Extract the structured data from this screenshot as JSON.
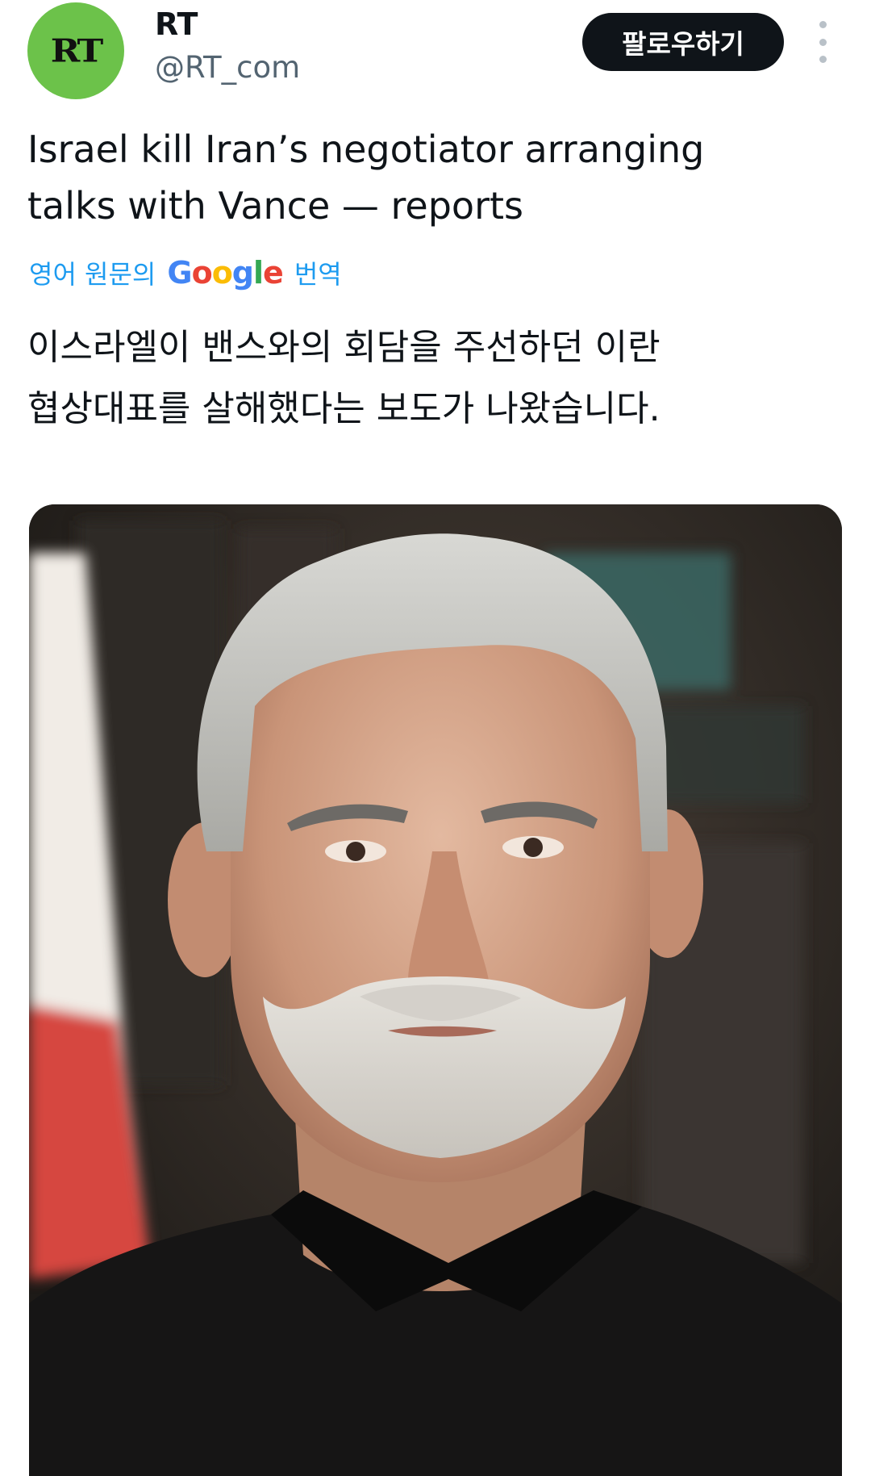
{
  "tweet": {
    "author": {
      "avatar_logo": "RT",
      "display_name": "RT",
      "handle": "@RT_com",
      "avatar_color": "#6cc24a"
    },
    "follow_label": "팔로우하기",
    "more_icon": "more-vertical-icon",
    "text_lines": [
      "Israel kill Iran’s negotiator arranging",
      "talks with Vance — reports"
    ],
    "translation": {
      "prefix": "영어 원문의",
      "google": [
        "G",
        "o",
        "o",
        "g",
        "l",
        "e"
      ],
      "suffix": "번역",
      "link_color": "#1d9bf0"
    },
    "translated_lines": [
      "이스라엘이 밴스와의 회담을 주선하던 이란",
      "협상대표를 살해했다는 보도가 나왔습니다."
    ]
  }
}
